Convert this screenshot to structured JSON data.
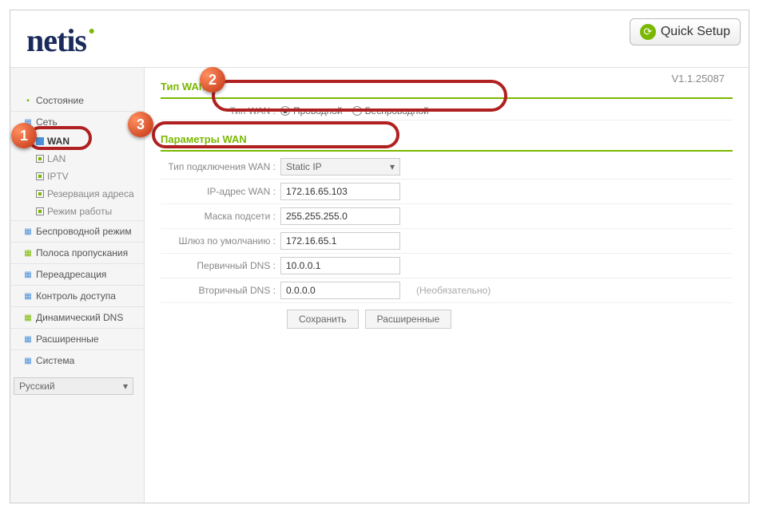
{
  "header": {
    "brand": "netis",
    "quick_setup": "Quick Setup",
    "version": "V1.1.25087"
  },
  "sidebar": {
    "items": [
      {
        "label": "Состояние"
      },
      {
        "label": "Сеть"
      },
      {
        "label": "Беспроводной режим"
      },
      {
        "label": "Полоса пропускания"
      },
      {
        "label": "Переадресация"
      },
      {
        "label": "Контроль доступа"
      },
      {
        "label": "Динамический DNS"
      },
      {
        "label": "Расширенные"
      },
      {
        "label": "Система"
      }
    ],
    "subs": [
      {
        "label": "WAN",
        "active": true
      },
      {
        "label": "LAN"
      },
      {
        "label": "IPTV"
      },
      {
        "label": "Резервация адреса"
      },
      {
        "label": "Режим работы"
      }
    ],
    "language": "Русский"
  },
  "wan_type": {
    "title": "Тип WAN",
    "label": "Тип WAN :",
    "wired": "Проводной",
    "wireless": "Беспроводной"
  },
  "wan_params": {
    "title": "Параметры WAN",
    "conn_type_label": "Тип подключения WAN :",
    "conn_type_value": "Static IP",
    "fields": {
      "ip_label": "IP-адрес WAN :",
      "ip_value": "172.16.65.103",
      "mask_label": "Маска подсети :",
      "mask_value": "255.255.255.0",
      "gw_label": "Шлюз по умолчанию :",
      "gw_value": "172.16.65.1",
      "dns1_label": "Первичный DNS :",
      "dns1_value": "10.0.0.1",
      "dns2_label": "Вторичный DNS :",
      "dns2_value": "0.0.0.0",
      "optional": "(Необязательно)"
    },
    "save": "Сохранить",
    "advanced": "Расширенные"
  },
  "annotations": {
    "n1": "1",
    "n2": "2",
    "n3": "3"
  }
}
